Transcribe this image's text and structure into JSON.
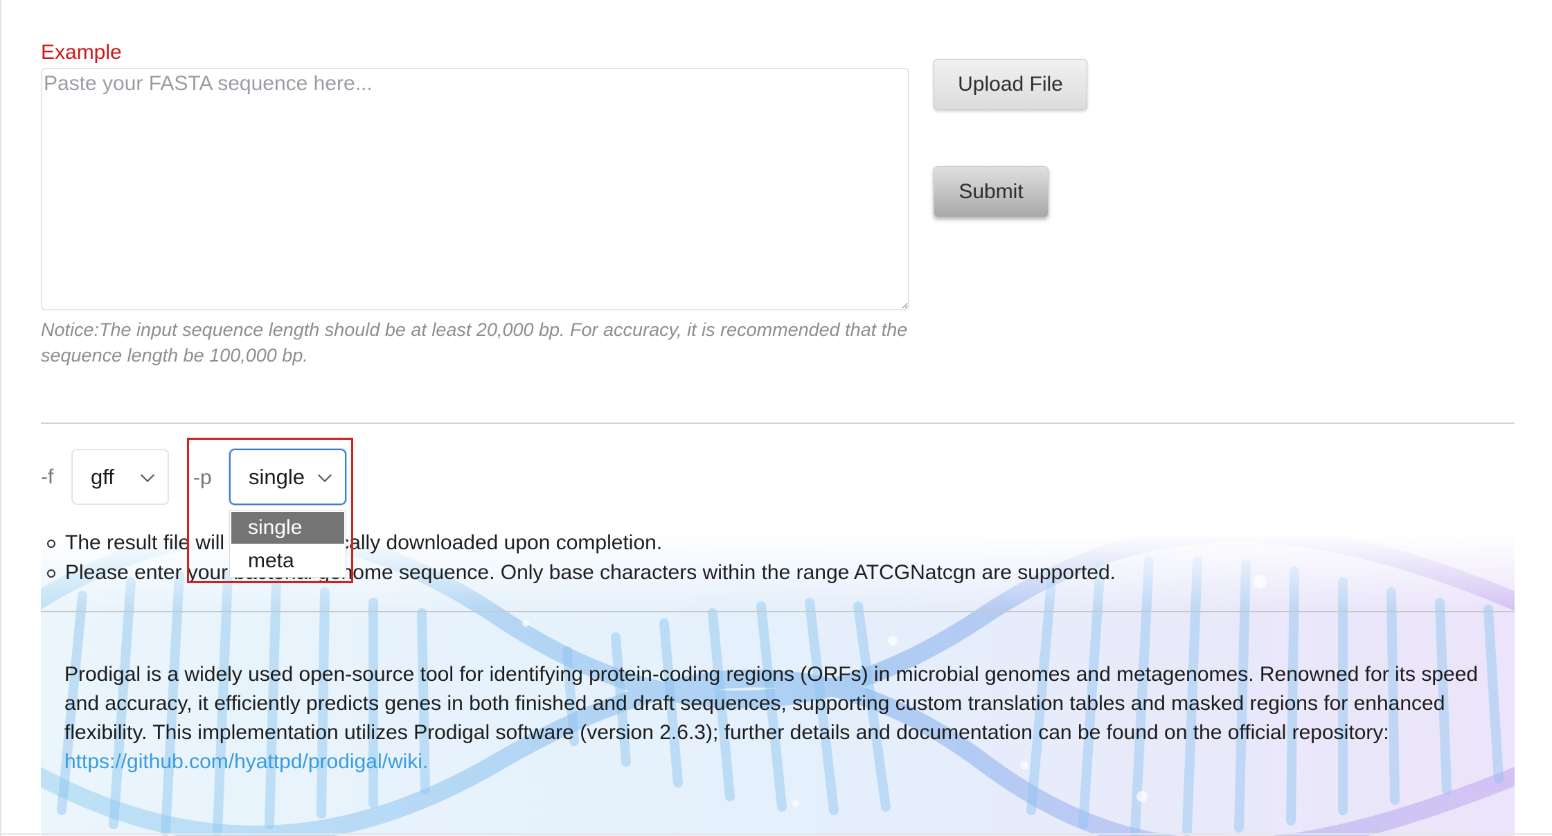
{
  "form": {
    "example_label": "Example",
    "fasta_placeholder": "Paste your FASTA sequence here...",
    "upload_label": "Upload File",
    "submit_label": "Submit",
    "notice": "Notice:The input sequence length should be at least 20,000 bp. For accuracy, it is recommended that the sequence length be 100,000 bp."
  },
  "options": {
    "f_label": "-f",
    "f_value": "gff",
    "p_label": "-p",
    "p_value": "single",
    "p_dropdown": [
      "single",
      "meta"
    ],
    "p_highlighted": "single"
  },
  "bullets": {
    "result_prefix": "The result file",
    "result_suffix": "will be automatically downloaded upon completion.",
    "enter_prefix": "Please enter",
    "enter_suffix": "your bacterial genome sequence. Only base characters within the range ATCGNatcgn are supported."
  },
  "description": {
    "text": "Prodigal is a widely used open-source tool for identifying protein-coding regions (ORFs) in microbial genomes and metagenomes. Renowned for its speed and accuracy, it efficiently predicts genes in both finished and draft sequences, supporting custom translation tables and masked regions for enhanced flexibility. This implementation utilizes Prodigal software (version 2.6.3); further details and documentation can be found on the official repository: ",
    "link_text": "https://github.com/hyattpd/prodigal/wiki."
  },
  "colors": {
    "example": "#d01818",
    "highlight_border": "#d62020",
    "link": "#3b9be0",
    "select_focus": "#3b7bd7",
    "dropdown_selected": "#747474"
  },
  "icons": {
    "select_arrow": "chevron-down-icon",
    "background": "dna-helix-graphic"
  }
}
